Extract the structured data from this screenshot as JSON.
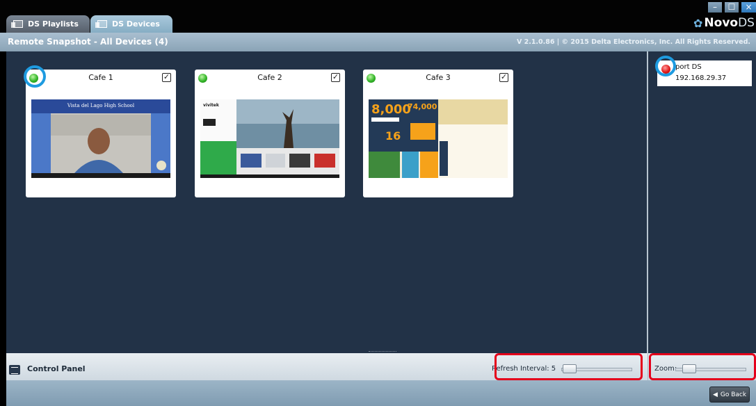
{
  "tabs": [
    {
      "label": "DS Playlists",
      "icon": "playlist-icon"
    },
    {
      "label": "DS Devices",
      "icon": "devices-icon"
    }
  ],
  "window_controls": {
    "minimize": "–",
    "maximize": "☐",
    "close": "×"
  },
  "logo": {
    "brand": "Novo",
    "suffix": "DS"
  },
  "header": {
    "title": "Remote Snapshot - All Devices (4)",
    "version_copyright": "V 2.1.0.86  |  © 2015 Delta Electronics, Inc. All Rights Reserved."
  },
  "devices": [
    {
      "name": "Cafe 1",
      "status": "online",
      "status_color": "#35b62a",
      "selected": true,
      "thumb_title": "Vista del Lago High School"
    },
    {
      "name": "Cafe 2",
      "status": "online",
      "status_color": "#35b62a",
      "selected": true,
      "thumb_brand": "vivitek"
    },
    {
      "name": "Cafe 3",
      "status": "online",
      "status_color": "#35b62a",
      "selected": true,
      "thumb_big": "8,000",
      "thumb_big2": "74,000"
    }
  ],
  "offline_device": {
    "name": "port DS",
    "ip": "192.168.29.37",
    "status": "offline",
    "status_color": "#e21b1b"
  },
  "control_panel": {
    "title": "Control Panel",
    "refresh_label": "Refresh Interval: 5",
    "refresh_value": 5,
    "zoom_label": "Zoom:"
  },
  "footer": {
    "go_back_label": "Go Back"
  },
  "colors": {
    "highlight": "#e4001b",
    "annotation_ring": "#1e9be0",
    "workspace": "#223247"
  }
}
